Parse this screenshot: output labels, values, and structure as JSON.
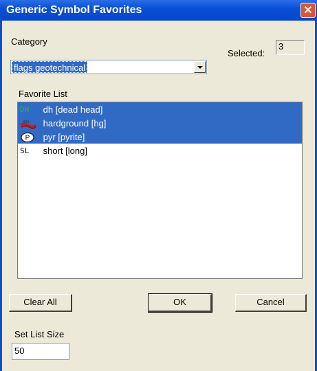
{
  "window": {
    "title": "Generic Symbol Favorites",
    "close": "✕"
  },
  "category": {
    "label": "Category",
    "selected_label": "Selected:",
    "selected_value": "3",
    "value": "flags geotechnical"
  },
  "favorites": {
    "label": "Favorite List",
    "items": [
      {
        "code": "DH",
        "text": "dh [dead head]",
        "selected": true,
        "icon": "dead-head-icon",
        "icon_color": "#26c126"
      },
      {
        "code": "",
        "text": "hardground [hg]",
        "selected": true,
        "icon": "hardground-icon",
        "icon_color": "#d01818"
      },
      {
        "code": "P",
        "text": "pyr [pyrite]",
        "selected": true,
        "icon": "pyrite-icon",
        "icon_color": "#000000"
      },
      {
        "code": "SL",
        "text": "short [long]",
        "selected": false,
        "icon": "short-long-icon",
        "icon_color": "#000000"
      }
    ]
  },
  "buttons": {
    "clear_all": "Clear All",
    "ok": "OK",
    "cancel": "Cancel"
  },
  "list_size": {
    "label": "Set List Size",
    "value": "50"
  }
}
